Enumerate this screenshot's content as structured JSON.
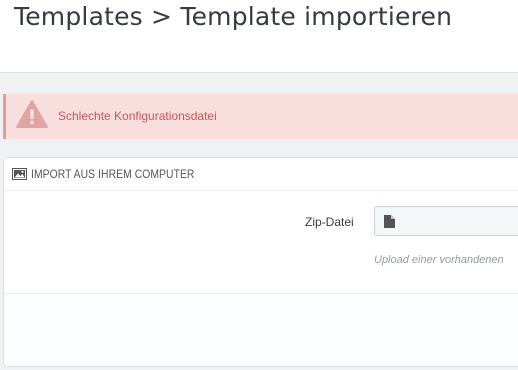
{
  "page": {
    "breadcrumb_title": "Templates > Template importieren"
  },
  "alert": {
    "icon": "warning-triangle-icon",
    "message": "Schlechte Konfigurationsdatei",
    "color_text": "#c4575a",
    "color_background": "#f9dede"
  },
  "import_panel": {
    "icon": "picture-icon",
    "heading": "IMPORT AUS IHREM COMPUTER",
    "zip_field": {
      "label": "Zip-Datei",
      "icon": "file-icon",
      "value": ""
    },
    "help_text": "Upload einer vorhandenen"
  }
}
